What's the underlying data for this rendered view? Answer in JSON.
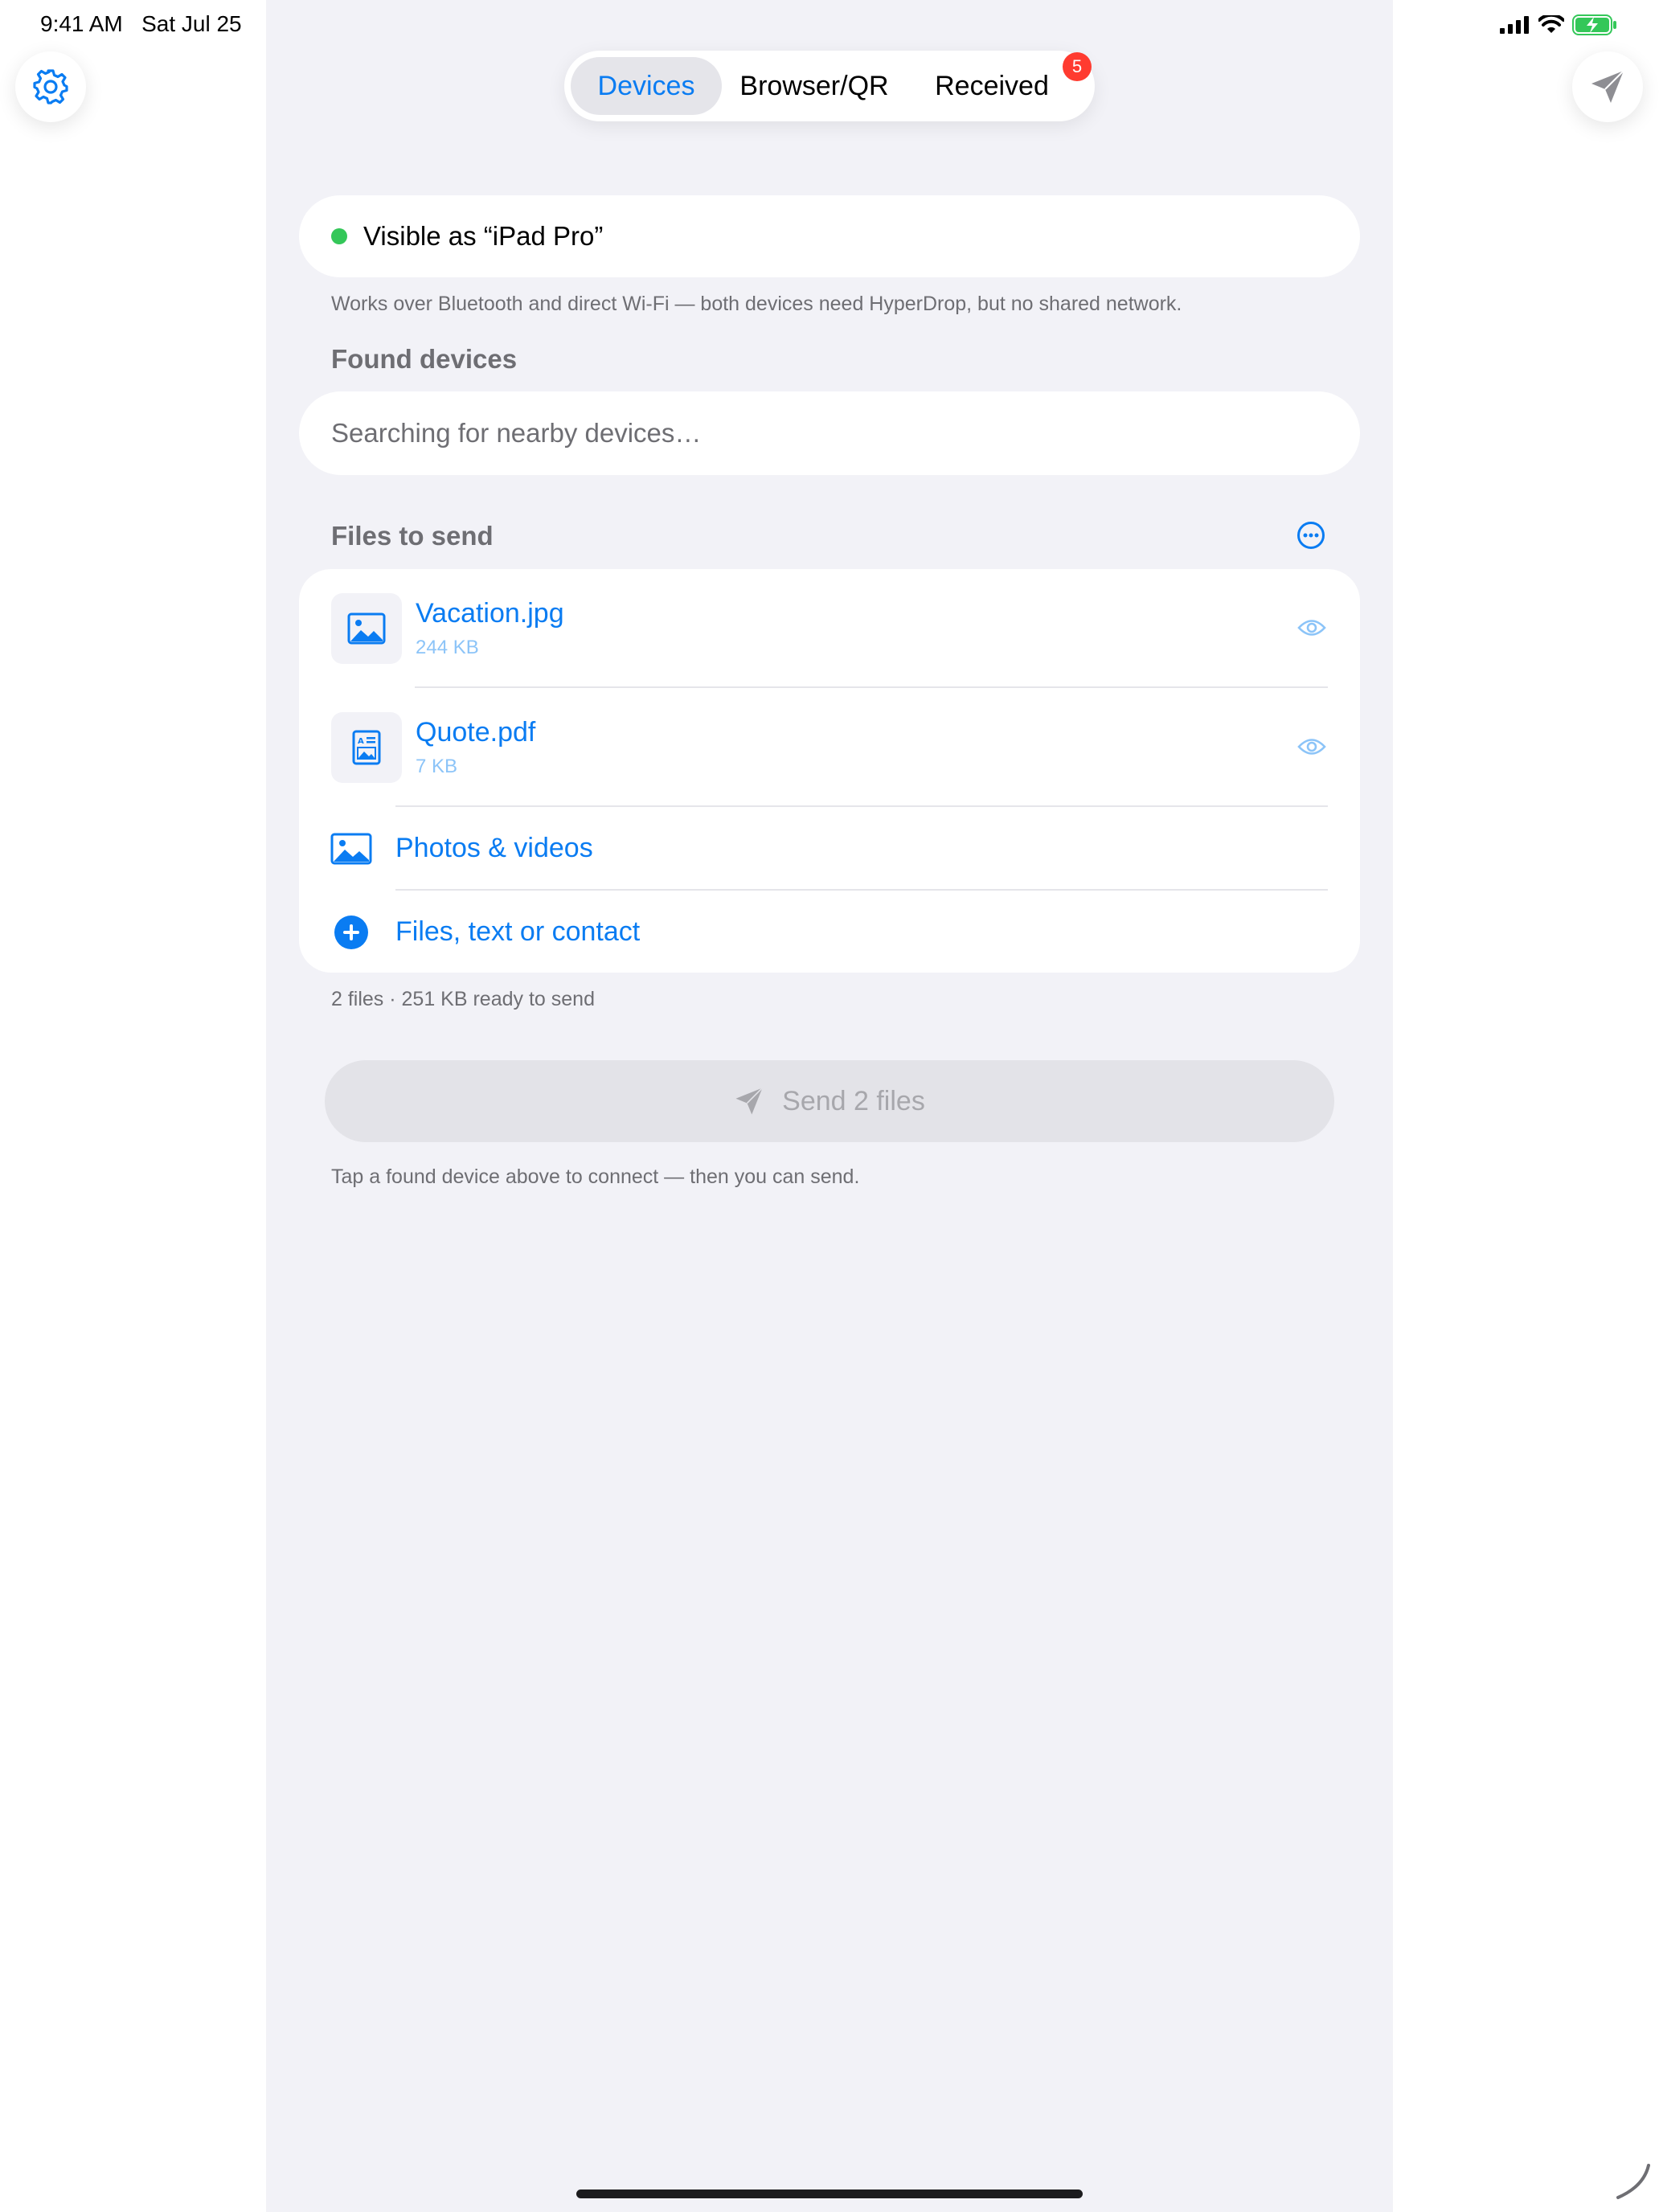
{
  "status_bar": {
    "time": "9:41 AM",
    "date": "Sat Jul 25",
    "icons": [
      "cellular-icon",
      "wifi-icon",
      "battery-charging-icon"
    ]
  },
  "toolbar": {
    "settings_icon": "gear-icon",
    "send_icon": "paper-plane-icon"
  },
  "segmented": {
    "tabs": [
      {
        "label": "Devices",
        "selected": true
      },
      {
        "label": "Browser/QR",
        "selected": false
      },
      {
        "label": "Received",
        "selected": false
      }
    ],
    "received_badge": "5"
  },
  "visibility": {
    "text": "Visible as “iPad Pro”",
    "status_color": "#34c759"
  },
  "hint_text": "Works over Bluetooth and direct Wi‑Fi — both devices need HyperDrop, but no shared network.",
  "found_devices": {
    "header": "Found devices",
    "searching_text": "Searching for nearby devices…"
  },
  "files_to_send": {
    "header": "Files to send",
    "files": [
      {
        "name": "Vacation.jpg",
        "size": "244 KB",
        "icon": "photo-icon"
      },
      {
        "name": "Quote.pdf",
        "size": "7 KB",
        "icon": "document-icon"
      }
    ],
    "actions": [
      {
        "label": "Photos & videos",
        "icon": "photo-icon"
      },
      {
        "label": "Files, text or contact",
        "icon": "plus-circle-icon"
      }
    ],
    "summary": "2 files · 251 KB ready to send"
  },
  "send_button": {
    "label": "Send 2 files",
    "enabled": false
  },
  "footer_hint": "Tap a found device above to connect — then you can send.",
  "colors": {
    "accent": "#0a7cf2",
    "background": "#f2f2f7",
    "badge": "#ff3b30"
  }
}
